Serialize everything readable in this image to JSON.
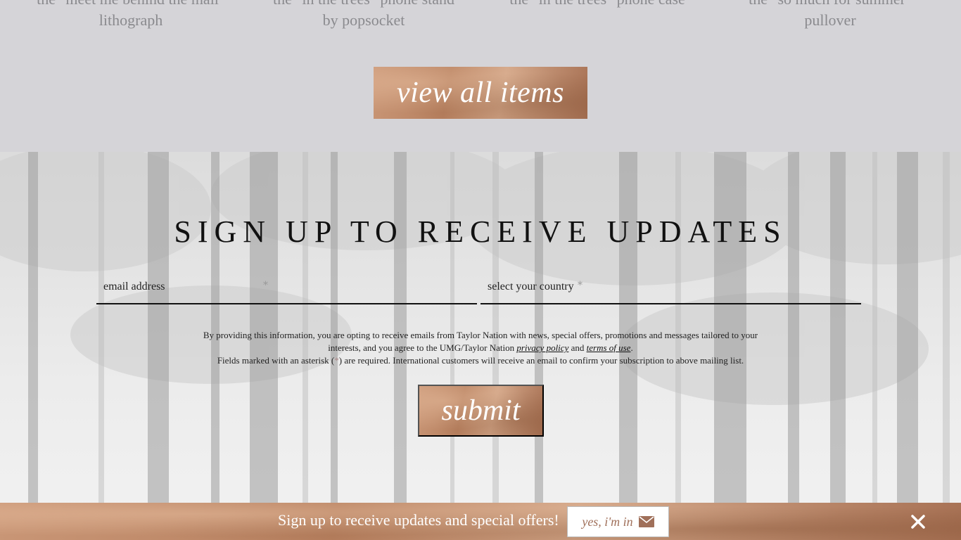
{
  "products": {
    "titles": [
      {
        "line1": "the \"meet me behind the mall\"",
        "line2": "lithograph"
      },
      {
        "line1": "the \"in the trees\" phone stand",
        "line2": "by popsocket"
      },
      {
        "line1": "the \"in the trees\" phone case",
        "line2": ""
      },
      {
        "line1": "the \"so much for summer\"",
        "line2": "pullover"
      }
    ],
    "view_all_label": "view all items"
  },
  "signup": {
    "title": "SIGN UP TO RECEIVE UPDATES",
    "email_placeholder": "email address",
    "country_placeholder": "select your country",
    "asterisk": "*",
    "legal": {
      "part1": "By providing this information, you are opting to receive emails from Taylor Nation with news, special offers, promotions and messages tailored to your interests, and you agree to the UMG/Taylor Nation ",
      "privacy_link": "privacy policy",
      "and": " and ",
      "terms_link": "terms of use",
      "period": ".",
      "part2a": "Fields marked with an asterisk (",
      "star": "*",
      "part2b": ") are required. International customers will receive an email to confirm your subscription to above mailing list."
    },
    "submit_label": "submit"
  },
  "promo_bar": {
    "text": "Sign up to receive updates and special offers!",
    "button_label": "yes, i'm in",
    "close": "✕"
  },
  "colors": {
    "copper": "#b7805f",
    "page_bg": "#d5d4d8"
  }
}
